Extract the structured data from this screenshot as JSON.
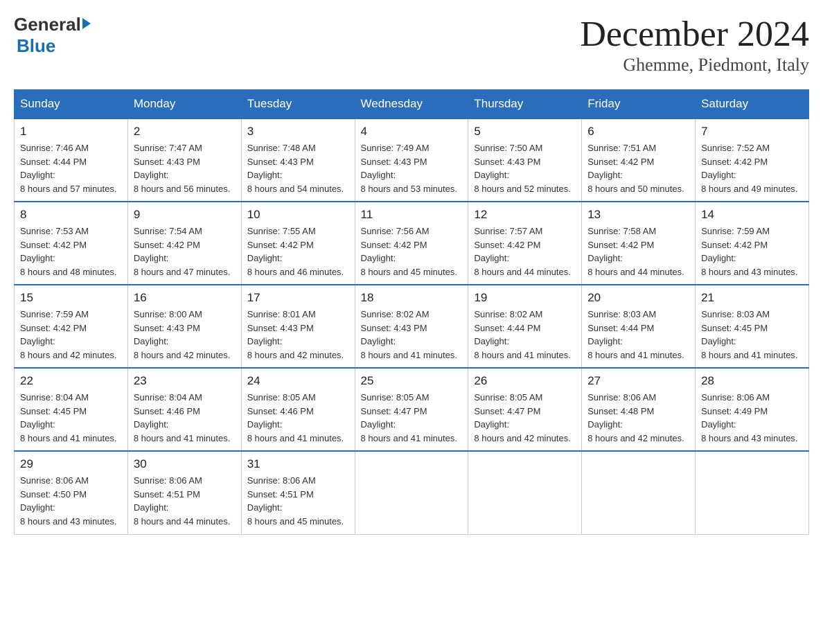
{
  "header": {
    "logo": {
      "general": "General",
      "blue": "Blue",
      "line1": "General",
      "line2": "Blue"
    },
    "title": "December 2024",
    "subtitle": "Ghemme, Piedmont, Italy"
  },
  "weekdays": [
    "Sunday",
    "Monday",
    "Tuesday",
    "Wednesday",
    "Thursday",
    "Friday",
    "Saturday"
  ],
  "weeks": [
    [
      {
        "day": "1",
        "sunrise": "7:46 AM",
        "sunset": "4:44 PM",
        "daylight": "8 hours and 57 minutes."
      },
      {
        "day": "2",
        "sunrise": "7:47 AM",
        "sunset": "4:43 PM",
        "daylight": "8 hours and 56 minutes."
      },
      {
        "day": "3",
        "sunrise": "7:48 AM",
        "sunset": "4:43 PM",
        "daylight": "8 hours and 54 minutes."
      },
      {
        "day": "4",
        "sunrise": "7:49 AM",
        "sunset": "4:43 PM",
        "daylight": "8 hours and 53 minutes."
      },
      {
        "day": "5",
        "sunrise": "7:50 AM",
        "sunset": "4:43 PM",
        "daylight": "8 hours and 52 minutes."
      },
      {
        "day": "6",
        "sunrise": "7:51 AM",
        "sunset": "4:42 PM",
        "daylight": "8 hours and 50 minutes."
      },
      {
        "day": "7",
        "sunrise": "7:52 AM",
        "sunset": "4:42 PM",
        "daylight": "8 hours and 49 minutes."
      }
    ],
    [
      {
        "day": "8",
        "sunrise": "7:53 AM",
        "sunset": "4:42 PM",
        "daylight": "8 hours and 48 minutes."
      },
      {
        "day": "9",
        "sunrise": "7:54 AM",
        "sunset": "4:42 PM",
        "daylight": "8 hours and 47 minutes."
      },
      {
        "day": "10",
        "sunrise": "7:55 AM",
        "sunset": "4:42 PM",
        "daylight": "8 hours and 46 minutes."
      },
      {
        "day": "11",
        "sunrise": "7:56 AM",
        "sunset": "4:42 PM",
        "daylight": "8 hours and 45 minutes."
      },
      {
        "day": "12",
        "sunrise": "7:57 AM",
        "sunset": "4:42 PM",
        "daylight": "8 hours and 44 minutes."
      },
      {
        "day": "13",
        "sunrise": "7:58 AM",
        "sunset": "4:42 PM",
        "daylight": "8 hours and 44 minutes."
      },
      {
        "day": "14",
        "sunrise": "7:59 AM",
        "sunset": "4:42 PM",
        "daylight": "8 hours and 43 minutes."
      }
    ],
    [
      {
        "day": "15",
        "sunrise": "7:59 AM",
        "sunset": "4:42 PM",
        "daylight": "8 hours and 42 minutes."
      },
      {
        "day": "16",
        "sunrise": "8:00 AM",
        "sunset": "4:43 PM",
        "daylight": "8 hours and 42 minutes."
      },
      {
        "day": "17",
        "sunrise": "8:01 AM",
        "sunset": "4:43 PM",
        "daylight": "8 hours and 42 minutes."
      },
      {
        "day": "18",
        "sunrise": "8:02 AM",
        "sunset": "4:43 PM",
        "daylight": "8 hours and 41 minutes."
      },
      {
        "day": "19",
        "sunrise": "8:02 AM",
        "sunset": "4:44 PM",
        "daylight": "8 hours and 41 minutes."
      },
      {
        "day": "20",
        "sunrise": "8:03 AM",
        "sunset": "4:44 PM",
        "daylight": "8 hours and 41 minutes."
      },
      {
        "day": "21",
        "sunrise": "8:03 AM",
        "sunset": "4:45 PM",
        "daylight": "8 hours and 41 minutes."
      }
    ],
    [
      {
        "day": "22",
        "sunrise": "8:04 AM",
        "sunset": "4:45 PM",
        "daylight": "8 hours and 41 minutes."
      },
      {
        "day": "23",
        "sunrise": "8:04 AM",
        "sunset": "4:46 PM",
        "daylight": "8 hours and 41 minutes."
      },
      {
        "day": "24",
        "sunrise": "8:05 AM",
        "sunset": "4:46 PM",
        "daylight": "8 hours and 41 minutes."
      },
      {
        "day": "25",
        "sunrise": "8:05 AM",
        "sunset": "4:47 PM",
        "daylight": "8 hours and 41 minutes."
      },
      {
        "day": "26",
        "sunrise": "8:05 AM",
        "sunset": "4:47 PM",
        "daylight": "8 hours and 42 minutes."
      },
      {
        "day": "27",
        "sunrise": "8:06 AM",
        "sunset": "4:48 PM",
        "daylight": "8 hours and 42 minutes."
      },
      {
        "day": "28",
        "sunrise": "8:06 AM",
        "sunset": "4:49 PM",
        "daylight": "8 hours and 43 minutes."
      }
    ],
    [
      {
        "day": "29",
        "sunrise": "8:06 AM",
        "sunset": "4:50 PM",
        "daylight": "8 hours and 43 minutes."
      },
      {
        "day": "30",
        "sunrise": "8:06 AM",
        "sunset": "4:51 PM",
        "daylight": "8 hours and 44 minutes."
      },
      {
        "day": "31",
        "sunrise": "8:06 AM",
        "sunset": "4:51 PM",
        "daylight": "8 hours and 45 minutes."
      },
      null,
      null,
      null,
      null
    ]
  ],
  "labels": {
    "sunrise_prefix": "Sunrise: ",
    "sunset_prefix": "Sunset: ",
    "daylight_prefix": "Daylight: "
  }
}
